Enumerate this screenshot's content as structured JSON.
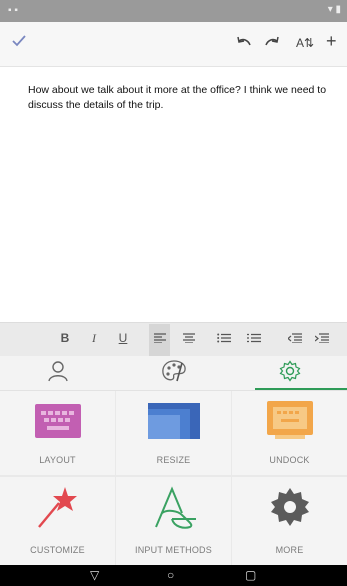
{
  "status_bar": {
    "left_glyphs": "▪ ▪",
    "right_glyphs": "▾ ▮"
  },
  "toolbar": {
    "confirm_icon": "checkmark-icon",
    "undo_icon": "undo-icon",
    "redo_icon": "redo-icon",
    "font_size_label": "A⇅",
    "add_label": "+"
  },
  "editor": {
    "text": "How about we talk about it more at the office? I think we need to discuss the details of the trip."
  },
  "format_bar": {
    "bold": "B",
    "italic": "I",
    "underline": "U",
    "buttons": [
      "align-left-icon",
      "align-center-icon",
      "bullets-icon",
      "numbering-icon",
      "indent-decrease-icon",
      "indent-increase-icon"
    ]
  },
  "tabs": [
    {
      "icon": "person-icon"
    },
    {
      "icon": "palette-icon"
    },
    {
      "icon": "gear-icon",
      "active": true
    }
  ],
  "accent_color": "#2e9b57",
  "tiles": [
    {
      "label": "LAYOUT",
      "icon": "keyboard-layout-icon"
    },
    {
      "label": "RESIZE",
      "icon": "resize-icon"
    },
    {
      "label": "UNDOCK",
      "icon": "undock-icon"
    },
    {
      "label": "CUSTOMIZE",
      "icon": "magic-wand-icon"
    },
    {
      "label": "INPUT METHODS",
      "icon": "input-methods-icon"
    },
    {
      "label": "MORE",
      "icon": "gear-icon"
    }
  ],
  "nav_bar": {
    "back": "▽",
    "home": "○",
    "recents": "▢"
  }
}
